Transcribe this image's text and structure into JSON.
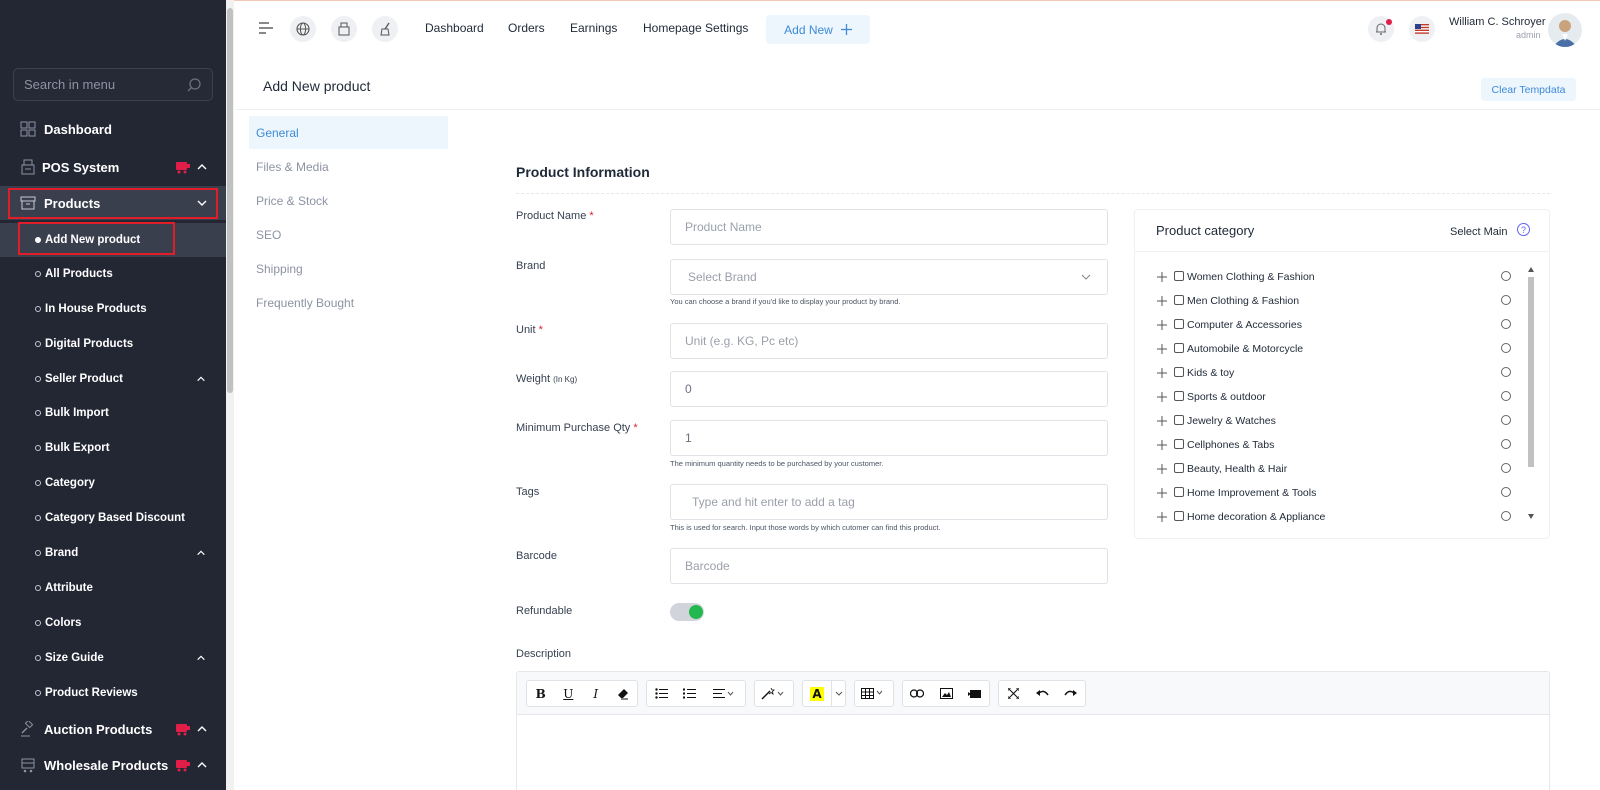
{
  "sidebar": {
    "search_placeholder": "Search in menu",
    "items": [
      {
        "label": "Dashboard"
      },
      {
        "label": "POS System"
      },
      {
        "label": "Products"
      }
    ],
    "products_sub": [
      {
        "label": "Add New product"
      },
      {
        "label": "All Products"
      },
      {
        "label": "In House Products"
      },
      {
        "label": "Digital Products"
      },
      {
        "label": "Seller Product"
      },
      {
        "label": "Bulk Import"
      },
      {
        "label": "Bulk Export"
      },
      {
        "label": "Category"
      },
      {
        "label": "Category Based Discount"
      },
      {
        "label": "Brand"
      },
      {
        "label": "Attribute"
      },
      {
        "label": "Colors"
      },
      {
        "label": "Size Guide"
      },
      {
        "label": "Product Reviews"
      }
    ],
    "bottom_items": [
      {
        "label": "Auction Products"
      },
      {
        "label": "Wholesale Products"
      }
    ]
  },
  "topbar": {
    "links": [
      "Dashboard",
      "Orders",
      "Earnings",
      "Homepage Settings"
    ],
    "add_new": "Add New",
    "user_name": "William C. Schroyer",
    "user_role": "admin"
  },
  "page": {
    "title": "Add New product",
    "clear_button": "Clear Tempdata"
  },
  "tabs": [
    "General",
    "Files & Media",
    "Price & Stock",
    "SEO",
    "Shipping",
    "Frequently Bought"
  ],
  "form": {
    "section_title": "Product Information",
    "product_name": {
      "label": "Product Name",
      "placeholder": "Product Name"
    },
    "brand": {
      "label": "Brand",
      "placeholder": "Select Brand",
      "help": "You can choose a brand if you'd like to display your product by brand."
    },
    "unit": {
      "label": "Unit",
      "placeholder": "Unit (e.g. KG, Pc etc)"
    },
    "weight": {
      "label": "Weight",
      "label_small": "(In Kg)",
      "value": "0"
    },
    "min_qty": {
      "label": "Minimum Purchase Qty",
      "value": "1",
      "help": "The minimum quantity needs to be purchased by your customer."
    },
    "tags": {
      "label": "Tags",
      "placeholder": "Type and hit enter to add a tag",
      "help": "This is used for search. Input those words by which cutomer can find this product."
    },
    "barcode": {
      "label": "Barcode",
      "placeholder": "Barcode"
    },
    "refundable": {
      "label": "Refundable",
      "enabled": true
    },
    "description": {
      "label": "Description"
    }
  },
  "category_panel": {
    "title": "Product category",
    "select_main": "Select Main",
    "help_glyph": "?",
    "categories": [
      "Women Clothing & Fashion",
      "Men Clothing & Fashion",
      "Computer & Accessories",
      "Automobile & Motorcycle",
      "Kids & toy",
      "Sports & outdoor",
      "Jewelry & Watches",
      "Cellphones & Tabs",
      "Beauty, Health & Hair",
      "Home Improvement & Tools",
      "Home decoration & Appliance"
    ]
  },
  "editor_toolbar": {
    "bold": "B",
    "underline": "U",
    "italic": "I",
    "color_letter": "A"
  },
  "colors": {
    "sidebar_bg": "#232734",
    "accent_blue": "#3c8ad8",
    "highlight_red": "#e11d2a",
    "toggle_green": "#22b84f"
  }
}
